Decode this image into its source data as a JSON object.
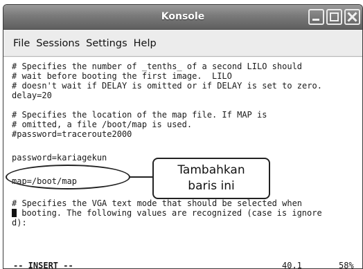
{
  "window": {
    "title": "Konsole"
  },
  "menu": [
    "File",
    "Sessions",
    "Settings",
    "Help"
  ],
  "terminal_lines": [
    "# Specifies the number of _tenths_ of a second LILO should",
    "# wait before booting the first image.  LILO",
    "# doesn't wait if DELAY is omitted or if DELAY is set to zero.",
    "delay=20",
    "",
    "# Specifies the location of the map file. If MAP is",
    "# omitted, a file /boot/map is used.",
    "#password=traceroute2000",
    "",
    "password=kariagekun",
    "",
    "map=/boot/map",
    "",
    "# Specifies the VGA text mode that should be selected when",
    "# booting. The following values are recognized (case is ignore",
    "d):"
  ],
  "status": {
    "mode": "-- INSERT --",
    "position": "40,1",
    "percent": "58%"
  },
  "callout": {
    "line1": "Tambahkan",
    "line2": "baris ini"
  }
}
